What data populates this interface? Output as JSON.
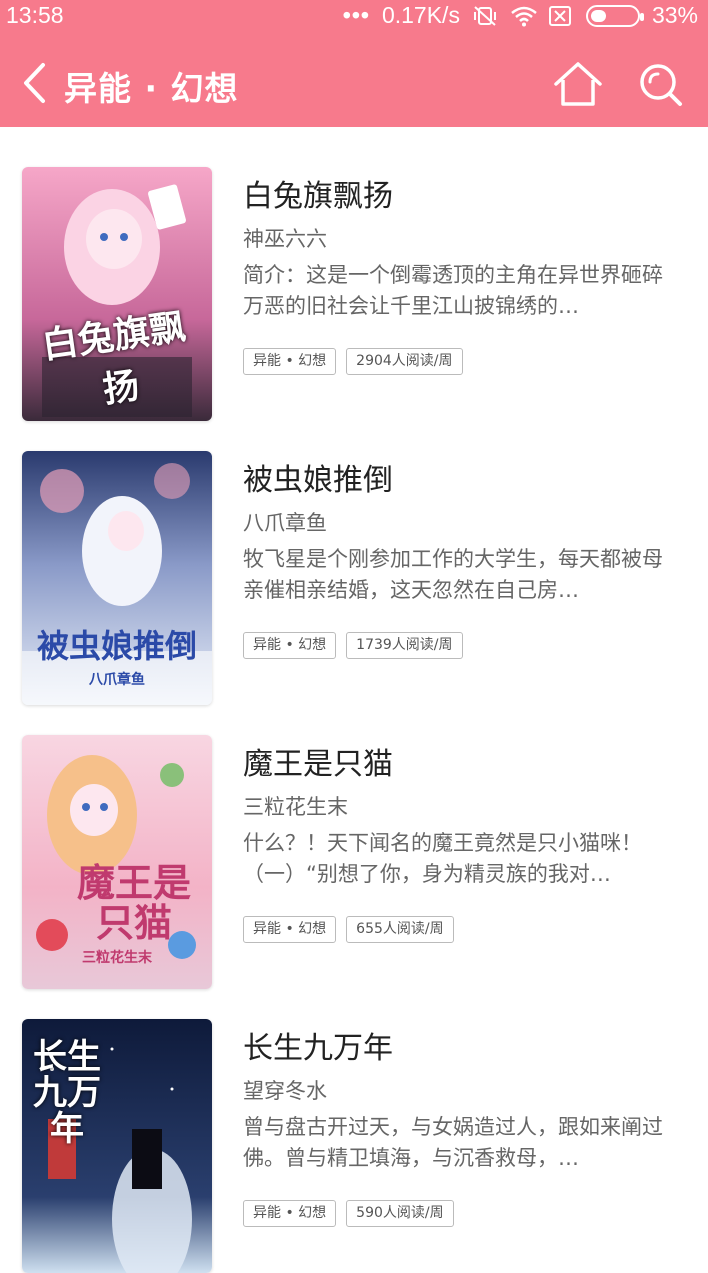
{
  "status_bar": {
    "time": "13:58",
    "dots": "•••",
    "net_speed": "0.17K/s",
    "battery": "33%",
    "battery_level": 0.33
  },
  "nav": {
    "title": "异能 · 幻想",
    "icons": [
      "back-chevron-icon",
      "home-icon",
      "search-icon"
    ]
  },
  "books": [
    {
      "title": "白兔旗飘扬",
      "author": "神巫六六",
      "intro": "简介：这是一个倒霉透顶的主角在异世界砸碎万恶的旧社会让千里江山披锦绣的…",
      "category": "异能 • 幻想",
      "readers": "2904人阅读/周",
      "cover_text": "白兔旗飘扬",
      "cover_colors": [
        "#f6a7c8",
        "#3a2a3a"
      ]
    },
    {
      "title": "被虫娘推倒",
      "author": "八爪章鱼",
      "intro": "牧飞星是个刚参加工作的大学生，每天都被母亲催相亲结婚，这天忽然在自己房…",
      "category": "异能 • 幻想",
      "readers": "1739人阅读/周",
      "cover_text": "被虫娘推倒",
      "cover_sub": "八爪章鱼",
      "cover_colors": [
        "#2a3a6e",
        "#d8e4f4"
      ]
    },
    {
      "title": "魔王是只猫",
      "author": "三粒花生末",
      "intro": "什么？！天下闻名的魔王竟然是只小猫咪！（一）“别想了你，身为精灵族的我对…",
      "category": "异能 • 幻想",
      "readers": "655人阅读/周",
      "cover_text": "魔王是只猫",
      "cover_sub": "三粒花生末",
      "cover_colors": [
        "#f8d6e2",
        "#c03a6e"
      ]
    },
    {
      "title": "长生九万年",
      "author": "望穿冬水",
      "intro": "曾与盘古开过天，与女娲造过人，跟如来阐过佛。曾与精卫填海，与沉香救母，…",
      "category": "异能 • 幻想",
      "readers": "590人阅读/周",
      "cover_text": "长生九万年",
      "cover_colors": [
        "#0e1a3a",
        "#cfe0f0"
      ]
    }
  ],
  "colors": {
    "accent": "#f77a8c",
    "tag_border": "#bbbbbb"
  }
}
